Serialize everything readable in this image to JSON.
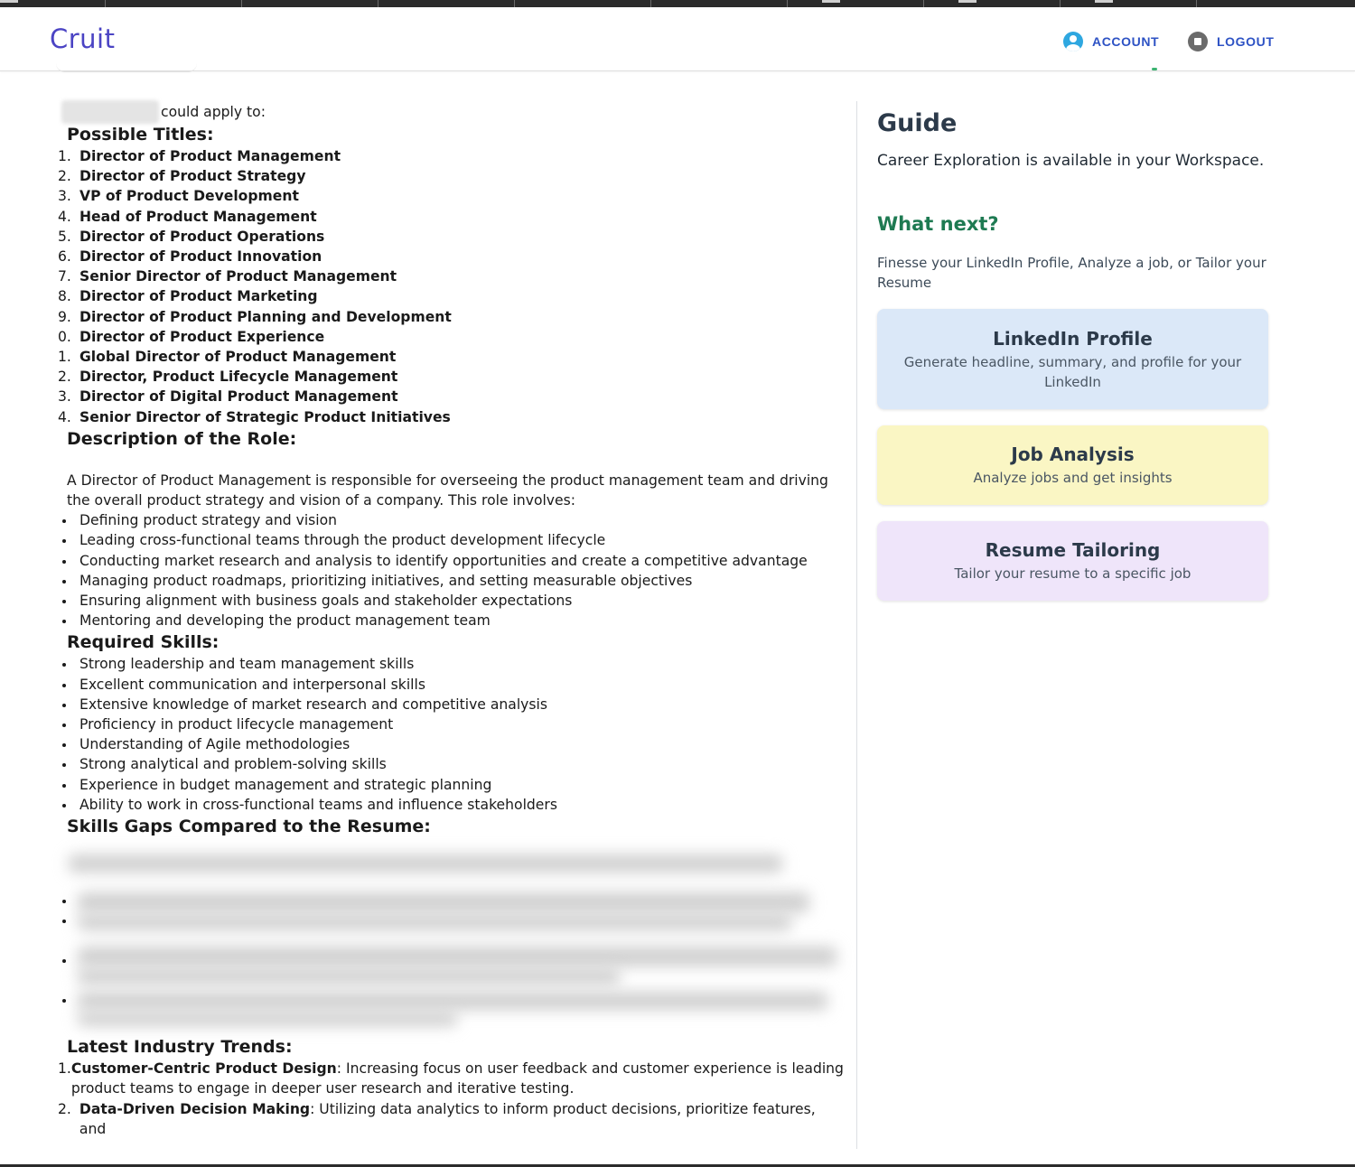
{
  "app": {
    "logo": "Cruit"
  },
  "nav": {
    "account_label": "ACCOUNT",
    "logout_label": "LOGOUT"
  },
  "main": {
    "intro_text": "could apply to:",
    "titles_heading": "Possible Titles:",
    "titles": [
      {
        "num": "1.",
        "text": "Director of Product Management"
      },
      {
        "num": "2.",
        "text": "Director of Product Strategy"
      },
      {
        "num": "3.",
        "text": "VP of Product Development"
      },
      {
        "num": "4.",
        "text": "Head of Product Management"
      },
      {
        "num": "5.",
        "text": "Director of Product Operations"
      },
      {
        "num": "6.",
        "text": "Director of Product Innovation"
      },
      {
        "num": "7.",
        "text": "Senior Director of Product Management"
      },
      {
        "num": "8.",
        "text": "Director of Product Marketing"
      },
      {
        "num": "9.",
        "text": "Director of Product Planning and Development"
      },
      {
        "num": "0.",
        "text": "Director of Product Experience"
      },
      {
        "num": "1.",
        "text": "Global Director of Product Management"
      },
      {
        "num": "2.",
        "text": "Director, Product Lifecycle Management"
      },
      {
        "num": "3.",
        "text": "Director of Digital Product Management"
      },
      {
        "num": "4.",
        "text": "Senior Director of Strategic Product Initiatives"
      }
    ],
    "description_heading": "Description of the Role:",
    "description_text": "A Director of Product Management is responsible for overseeing the product management team and driving the overall product strategy and vision of a company. This role involves:",
    "description_items": [
      "Defining product strategy and vision",
      "Leading cross-functional teams through the product development lifecycle",
      "Conducting market research and analysis to identify opportunities and create a competitive advantage",
      "Managing product roadmaps, prioritizing initiatives, and setting measurable objectives",
      "Ensuring alignment with business goals and stakeholder expectations",
      "Mentoring and developing the product management team"
    ],
    "skills_heading": "Required Skills:",
    "skills": [
      "Strong leadership and team management skills",
      "Excellent communication and interpersonal skills",
      "Extensive knowledge of market research and competitive analysis",
      "Proficiency in product lifecycle management",
      "Understanding of Agile methodologies",
      "Strong analytical and problem-solving skills",
      "Experience in budget management and strategic planning",
      "Ability to work in cross-functional teams and influence stakeholders"
    ],
    "gaps_heading": "Skills Gaps Compared to the Resume:",
    "trends_heading": "Latest Industry Trends:",
    "trends": [
      {
        "num": "1.",
        "label": "Customer-Centric Product Design",
        "text": ": Increasing focus on user feedback and customer experience is leading product teams to engage in deeper user research and iterative testing."
      },
      {
        "num": "2.",
        "label": "Data-Driven Decision Making",
        "text": ": Utilizing data analytics to inform product decisions, prioritize features, and"
      }
    ]
  },
  "guide": {
    "title": "Guide",
    "availability": "Career Exploration is available in your Workspace.",
    "what_next": "What next?",
    "finesse": "Finesse your LinkedIn Profile, Analyze a job, or Tailor your Resume",
    "cards": {
      "linkedin": {
        "title": "LinkedIn Profile",
        "subtitle": "Generate headline, summary, and profile for your LinkedIn",
        "color": "#dbe8f8"
      },
      "job": {
        "title": "Job Analysis",
        "subtitle": "Analyze jobs and get insights",
        "color": "#faf6c4"
      },
      "resume": {
        "title": "Resume Tailoring",
        "subtitle": "Tailor your resume to a specific job",
        "color": "#efe5fa"
      }
    }
  },
  "colors": {
    "logo": "#4b44c4",
    "nav": "#2d52c4",
    "what_next": "#1e7a52"
  },
  "icons": {
    "account": "user-circle-icon",
    "logout": "stop-circle-icon"
  }
}
